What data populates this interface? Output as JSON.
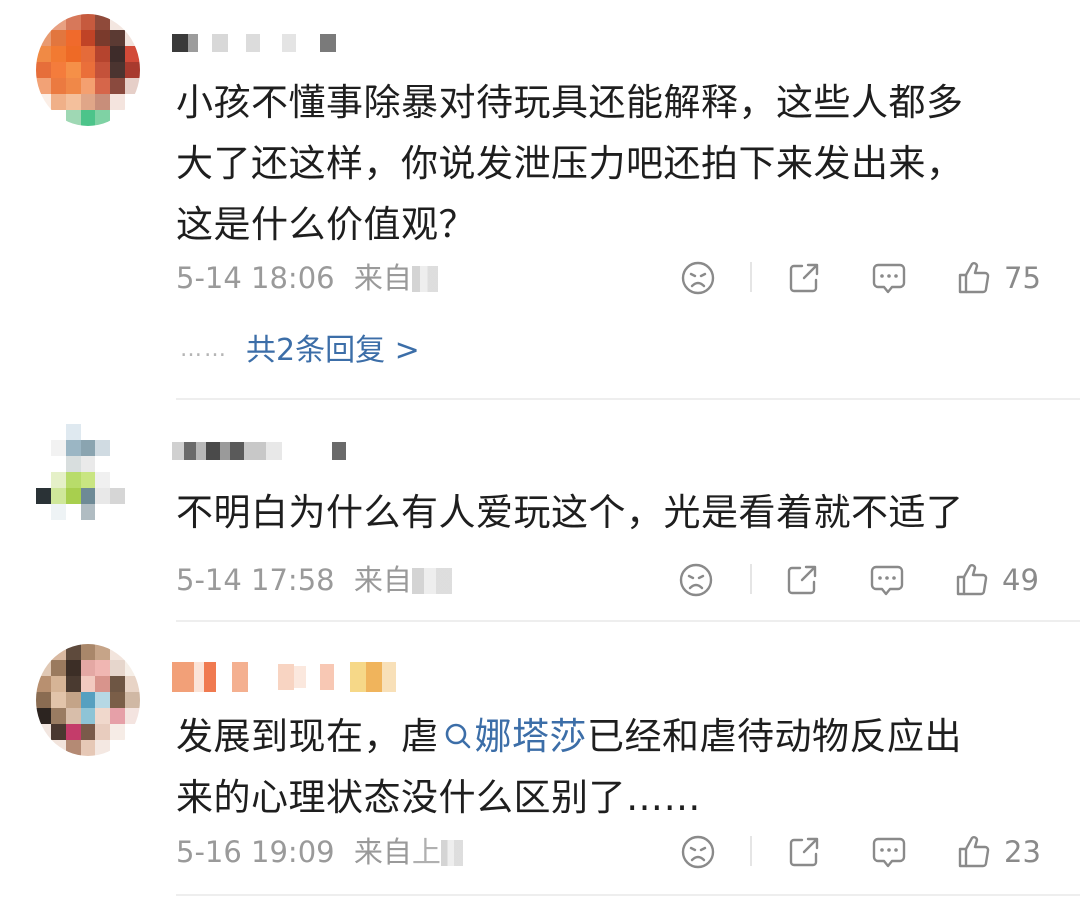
{
  "comments": [
    {
      "text_lines": [
        "小孩不懂事除暴对待玩具还能解释，这些人都多",
        "大了还这样，你说发泄压力吧还拍下来发出来，",
        "这是什么价值观？"
      ],
      "time": "5-14 18:06",
      "source_prefix": "来自",
      "likes": "75",
      "replies_label": "共2条回复 >",
      "replies_dots": "……"
    },
    {
      "text_lines": [
        "不明白为什么有人爱玩这个，光是看着就不适了"
      ],
      "time": "5-14 17:58",
      "source_prefix": "来自",
      "likes": "49"
    },
    {
      "text_before_topic": "发展到现在，虐",
      "topic": "娜塔莎",
      "text_after_topic": "已经和虐待动物反应出",
      "text_line2": "来的心理状态没什么区别了……",
      "time": "5-16 19:09",
      "source_prefix": "来自",
      "source_partial": "上",
      "likes": "23"
    }
  ],
  "icons": {
    "reaction": "sad-face-icon",
    "share": "share-icon",
    "comment": "comment-icon",
    "like": "thumbs-up-icon",
    "topic": "search-icon"
  },
  "colors": {
    "text": "#1e1e1e",
    "meta": "#9a9a9a",
    "link": "#3c6ea8",
    "separator": "#eeeeee"
  }
}
